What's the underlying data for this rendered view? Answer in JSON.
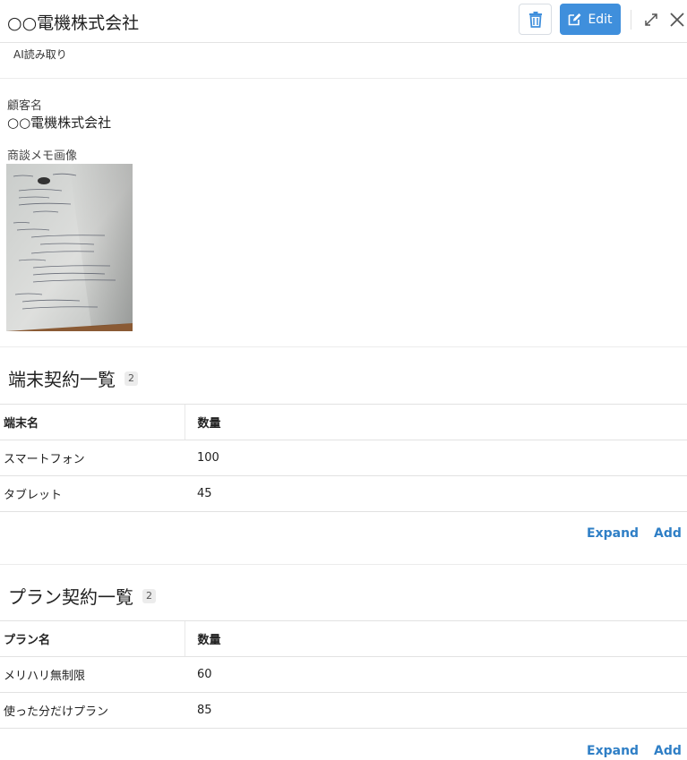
{
  "header": {
    "title": "○○電機株式会社",
    "edit_label": "Edit",
    "accent_color": "#3f8fdc"
  },
  "tabs": {
    "ai_reading": "AI読み取り"
  },
  "fields": {
    "customer_name_label": "顧客名",
    "customer_name_value": "○○電機株式会社",
    "memo_image_label": "商談メモ画像"
  },
  "terminal_contracts": {
    "title": "端末契約一覧",
    "count": "2",
    "columns": [
      "端末名",
      "数量"
    ],
    "rows": [
      [
        "スマートフォン",
        "100"
      ],
      [
        "タブレット",
        "45"
      ]
    ],
    "expand_label": "Expand",
    "add_label": "Add"
  },
  "plan_contracts": {
    "title": "プラン契約一覧",
    "count": "2",
    "columns": [
      "プラン名",
      "数量"
    ],
    "rows": [
      [
        "メリハリ無制限",
        "60"
      ],
      [
        "使った分だけプラン",
        "85"
      ]
    ],
    "expand_label": "Expand",
    "add_label": "Add"
  },
  "icons": {
    "delete": "trash-icon",
    "edit": "edit-icon",
    "expand_window": "expand-arrows-icon",
    "close": "close-icon"
  }
}
